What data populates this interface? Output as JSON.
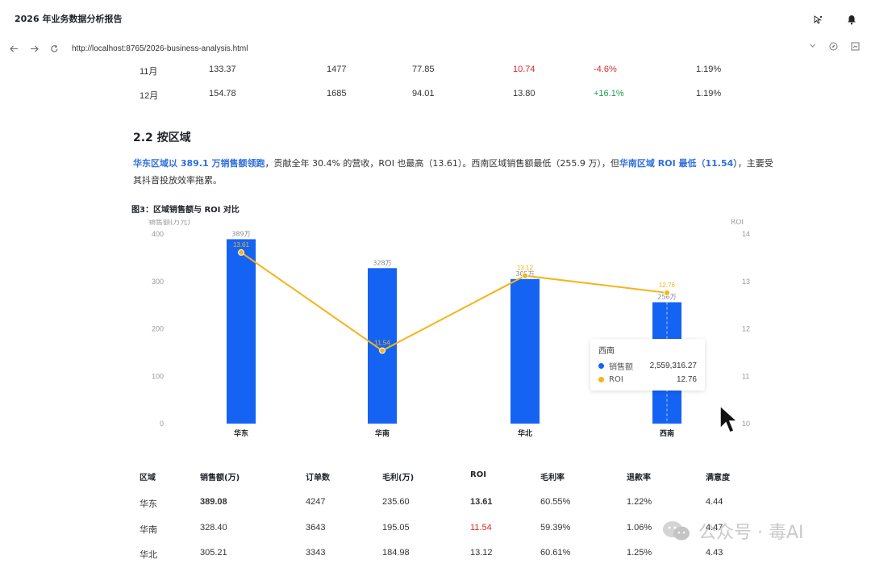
{
  "window": {
    "title": "2026 年业务数据分析报告",
    "url": "http://localhost:8765/2026-business-analysis.html"
  },
  "monthly_rows": [
    {
      "month": "11月",
      "sales": "133.37",
      "orders": "1477",
      "profit": "77.85",
      "roi": "10.74",
      "mom": "-4.6%",
      "refund": "1.19%"
    },
    {
      "month": "12月",
      "sales": "154.78",
      "orders": "1685",
      "profit": "94.01",
      "roi": "13.80",
      "mom": "+16.1%",
      "refund": "1.19%"
    }
  ],
  "section": {
    "heading": "2.2 按区域",
    "para_hl1": "华东区域以 389.1 万销售额领跑",
    "para_mid": "，贡献全年 30.4% 的营收，ROI 也最高（13.61）。西南区域销售额最低（255.9 万），但",
    "para_hl2": "华南区域 ROI 最低（11.54）",
    "para_end": "，主要受其抖音投放效率拖累。",
    "figure_title": "图3：区域销售额与 ROI 对比"
  },
  "chart_data": {
    "type": "bar",
    "title": "图3：区域销售额与 ROI 对比",
    "categories": [
      "华东",
      "华南",
      "华北",
      "西南"
    ],
    "series": [
      {
        "name": "销售额",
        "values": [
          389,
          328,
          305,
          256
        ],
        "labels": [
          "389万",
          "328万",
          "305万",
          "256万"
        ],
        "axis": "left",
        "color": "#1463f3"
      },
      {
        "name": "ROI",
        "values": [
          13.61,
          11.54,
          13.12,
          12.76
        ],
        "axis": "right",
        "color": "#f5b417"
      }
    ],
    "y_left": {
      "ticks": [
        0,
        100,
        200,
        300,
        400
      ],
      "range": [
        0,
        400
      ],
      "label": "销售额(万元)"
    },
    "y_right": {
      "ticks": [
        10,
        11,
        12,
        13,
        14
      ],
      "range": [
        10,
        14
      ],
      "label": "ROI"
    },
    "grid": false
  },
  "tooltip": {
    "title": "西南",
    "rows": [
      {
        "label": "销售额",
        "value": "2,559,316.27",
        "color": "#1463f3"
      },
      {
        "label": "ROI",
        "value": "12.76",
        "color": "#f5b417"
      }
    ]
  },
  "region_table": {
    "headers": [
      "区域",
      "销售额(万)",
      "订单数",
      "毛利(万)",
      "ROI",
      "毛利率",
      "退款率",
      "满意度"
    ],
    "rows": [
      [
        "华东",
        "389.08",
        "4247",
        "235.60",
        "13.61",
        "60.55%",
        "1.22%",
        "4.44"
      ],
      [
        "华南",
        "328.40",
        "3643",
        "195.05",
        "11.54",
        "59.39%",
        "1.06%",
        "4.47"
      ],
      [
        "华北",
        "305.21",
        "3343",
        "184.98",
        "13.12",
        "60.61%",
        "1.25%",
        "4.43"
      ]
    ]
  },
  "watermark": {
    "text": "公众号 · 毒AI"
  },
  "colors": {
    "accent": "#2f6fde",
    "bar": "#1463f3",
    "line": "#f5b417",
    "negative": "#d92b2b",
    "positive": "#1f9d55"
  }
}
